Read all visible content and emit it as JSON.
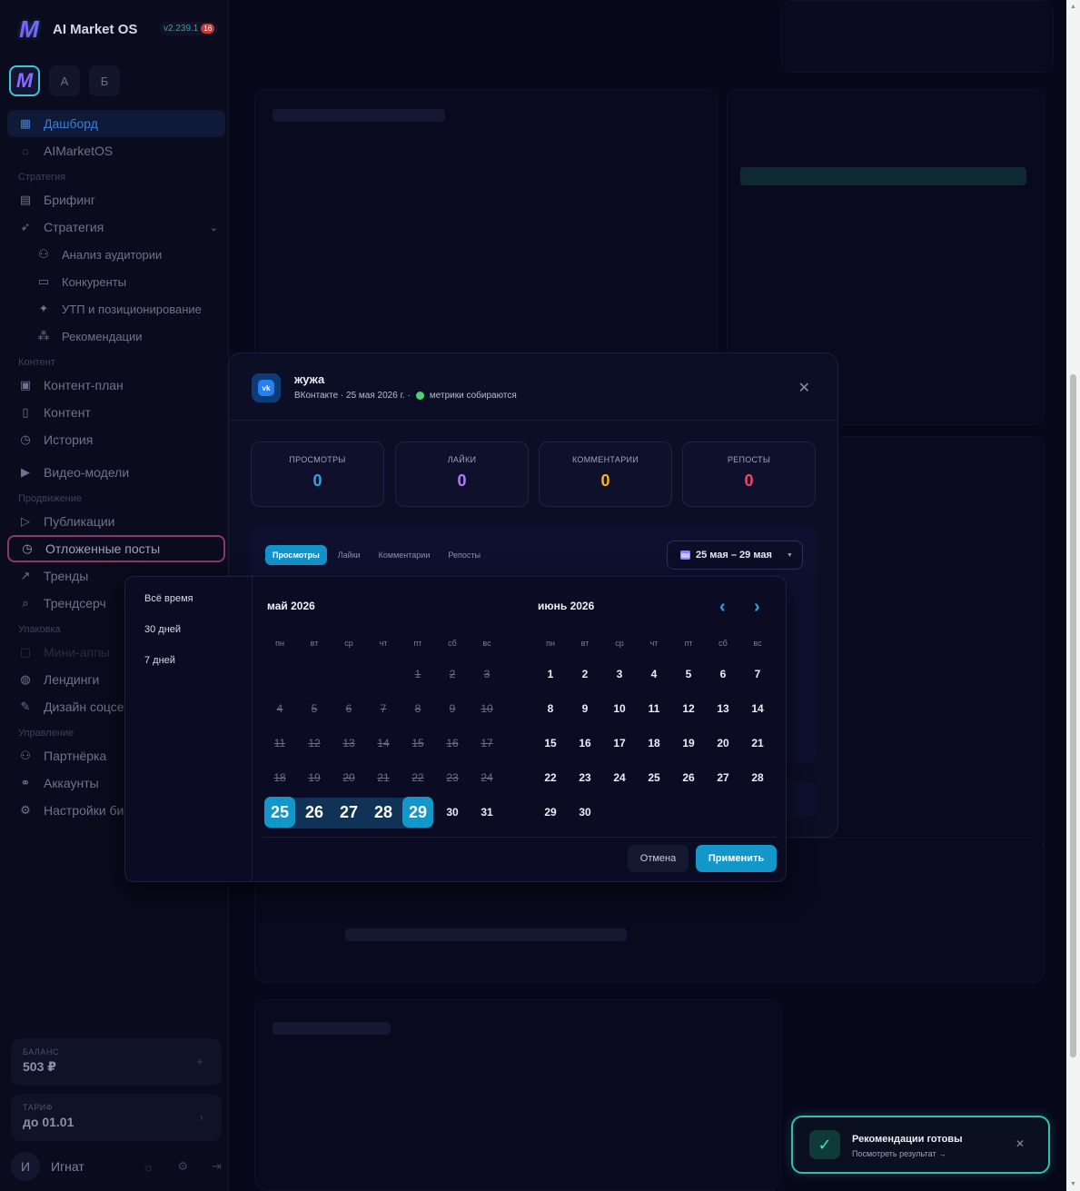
{
  "app": {
    "title": "AI Market OS",
    "version": "v2.239.1",
    "notif_count": "16"
  },
  "workspaces": {
    "w1": "A",
    "w2": "Б"
  },
  "nav": {
    "dashboard": "Дашборд",
    "aimarketos": "AIMarketOS",
    "section_strategy": "Стратегия",
    "brief": "Брифинг",
    "strategy": "Стратегия",
    "audience": "Анализ аудитории",
    "competitors": "Конкуренты",
    "usp": "УТП и позиционирование",
    "recommendations": "Рекомендации",
    "section_content": "Контент",
    "content_plan": "Контент-план",
    "content": "Контент",
    "history": "История",
    "video_models": "Видео-модели",
    "section_promo": "Продвижение",
    "publications": "Публикации",
    "scheduled": "Отложенные посты",
    "trends": "Тренды",
    "trendsearch": "Трендсерч",
    "section_pack": "Упаковка",
    "minisites": "Мини-аппы",
    "landings": "Лендинги",
    "social_design": "Дизайн соцсетей",
    "section_manage": "Управление",
    "partners": "Партнёрка",
    "accounts": "Аккаунты",
    "biz_settings": "Настройки бизнеса"
  },
  "balance": {
    "label": "БАЛАНС",
    "value": "503 ₽"
  },
  "tariff": {
    "label": "ТАРИФ",
    "value": "до 01.01"
  },
  "user": {
    "initial": "И",
    "name": "Игнат"
  },
  "modal": {
    "title": "жужа",
    "meta": "ВКонтакте · 25 мая 2026 г. ·",
    "status": "метрики собираются",
    "vk_label": "vk",
    "metrics": [
      {
        "label": "ПРОСМОТРЫ",
        "value": "0",
        "color": "#2aa7e8"
      },
      {
        "label": "ЛАЙКИ",
        "value": "0",
        "color": "#b07cff"
      },
      {
        "label": "КОММЕНТАРИИ",
        "value": "0",
        "color": "#f5b325"
      },
      {
        "label": "РЕПОСТЫ",
        "value": "0",
        "color": "#f0466a"
      }
    ],
    "tabs": [
      "Просмотры",
      "Лайки",
      "Комментарии",
      "Репосты"
    ],
    "range": "25 мая – 29 мая"
  },
  "picker": {
    "presets": [
      "Всё время",
      "30 дней",
      "7 дней"
    ],
    "month_left": "май 2026",
    "month_right": "июнь 2026",
    "weekdays": [
      "пн",
      "вт",
      "ср",
      "чт",
      "пт",
      "сб",
      "вс"
    ],
    "cancel": "Отмена",
    "apply": "Применить"
  },
  "toast": {
    "title": "Рекомендации готовы",
    "subtitle": "Посмотреть результат →"
  },
  "colors": {
    "accent": "#1397c8",
    "toast_border": "#2ec0b0",
    "active_nav_border": "#8a3a62"
  }
}
